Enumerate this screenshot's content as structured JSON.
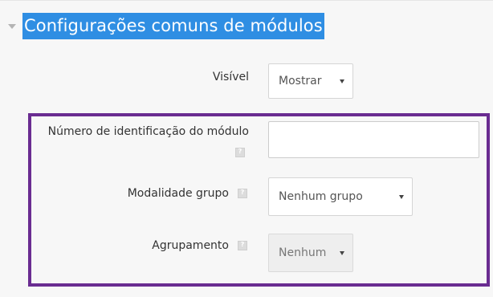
{
  "section": {
    "title": "Configurações comuns de módulos"
  },
  "fields": {
    "visible": {
      "label": "Visível",
      "value": "Mostrar"
    },
    "idnumber": {
      "label": "Número de identificação do módulo",
      "value": ""
    },
    "groupmode": {
      "label": "Modalidade grupo",
      "value": "Nenhum grupo"
    },
    "grouping": {
      "label": "Agrupamento",
      "value": "Nenhum"
    }
  },
  "colors": {
    "title_highlight": "#2f8ee3",
    "annotation_border": "#6a2c91",
    "panel_background": "#f7f7f7"
  }
}
